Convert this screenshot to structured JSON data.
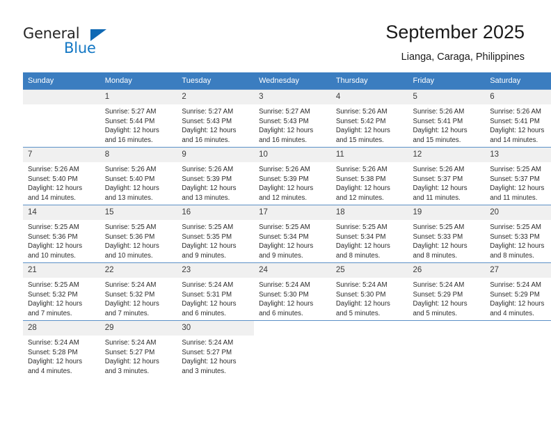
{
  "brand": {
    "name_part1": "General",
    "name_part2": "Blue",
    "triangle_color": "#1069b4"
  },
  "header": {
    "title": "September 2025",
    "subtitle": "Lianga, Caraga, Philippines",
    "header_bg": "#3b7dc0"
  },
  "weekdays": [
    "Sunday",
    "Monday",
    "Tuesday",
    "Wednesday",
    "Thursday",
    "Friday",
    "Saturday"
  ],
  "weeks": [
    [
      {
        "day": "",
        "sunrise": "",
        "sunset": "",
        "daylight1": "",
        "daylight2": "",
        "empty": true
      },
      {
        "day": "1",
        "sunrise": "Sunrise: 5:27 AM",
        "sunset": "Sunset: 5:44 PM",
        "daylight1": "Daylight: 12 hours",
        "daylight2": "and 16 minutes."
      },
      {
        "day": "2",
        "sunrise": "Sunrise: 5:27 AM",
        "sunset": "Sunset: 5:43 PM",
        "daylight1": "Daylight: 12 hours",
        "daylight2": "and 16 minutes."
      },
      {
        "day": "3",
        "sunrise": "Sunrise: 5:27 AM",
        "sunset": "Sunset: 5:43 PM",
        "daylight1": "Daylight: 12 hours",
        "daylight2": "and 16 minutes."
      },
      {
        "day": "4",
        "sunrise": "Sunrise: 5:26 AM",
        "sunset": "Sunset: 5:42 PM",
        "daylight1": "Daylight: 12 hours",
        "daylight2": "and 15 minutes."
      },
      {
        "day": "5",
        "sunrise": "Sunrise: 5:26 AM",
        "sunset": "Sunset: 5:41 PM",
        "daylight1": "Daylight: 12 hours",
        "daylight2": "and 15 minutes."
      },
      {
        "day": "6",
        "sunrise": "Sunrise: 5:26 AM",
        "sunset": "Sunset: 5:41 PM",
        "daylight1": "Daylight: 12 hours",
        "daylight2": "and 14 minutes."
      }
    ],
    [
      {
        "day": "7",
        "sunrise": "Sunrise: 5:26 AM",
        "sunset": "Sunset: 5:40 PM",
        "daylight1": "Daylight: 12 hours",
        "daylight2": "and 14 minutes."
      },
      {
        "day": "8",
        "sunrise": "Sunrise: 5:26 AM",
        "sunset": "Sunset: 5:40 PM",
        "daylight1": "Daylight: 12 hours",
        "daylight2": "and 13 minutes."
      },
      {
        "day": "9",
        "sunrise": "Sunrise: 5:26 AM",
        "sunset": "Sunset: 5:39 PM",
        "daylight1": "Daylight: 12 hours",
        "daylight2": "and 13 minutes."
      },
      {
        "day": "10",
        "sunrise": "Sunrise: 5:26 AM",
        "sunset": "Sunset: 5:39 PM",
        "daylight1": "Daylight: 12 hours",
        "daylight2": "and 12 minutes."
      },
      {
        "day": "11",
        "sunrise": "Sunrise: 5:26 AM",
        "sunset": "Sunset: 5:38 PM",
        "daylight1": "Daylight: 12 hours",
        "daylight2": "and 12 minutes."
      },
      {
        "day": "12",
        "sunrise": "Sunrise: 5:26 AM",
        "sunset": "Sunset: 5:37 PM",
        "daylight1": "Daylight: 12 hours",
        "daylight2": "and 11 minutes."
      },
      {
        "day": "13",
        "sunrise": "Sunrise: 5:25 AM",
        "sunset": "Sunset: 5:37 PM",
        "daylight1": "Daylight: 12 hours",
        "daylight2": "and 11 minutes."
      }
    ],
    [
      {
        "day": "14",
        "sunrise": "Sunrise: 5:25 AM",
        "sunset": "Sunset: 5:36 PM",
        "daylight1": "Daylight: 12 hours",
        "daylight2": "and 10 minutes."
      },
      {
        "day": "15",
        "sunrise": "Sunrise: 5:25 AM",
        "sunset": "Sunset: 5:36 PM",
        "daylight1": "Daylight: 12 hours",
        "daylight2": "and 10 minutes."
      },
      {
        "day": "16",
        "sunrise": "Sunrise: 5:25 AM",
        "sunset": "Sunset: 5:35 PM",
        "daylight1": "Daylight: 12 hours",
        "daylight2": "and 9 minutes."
      },
      {
        "day": "17",
        "sunrise": "Sunrise: 5:25 AM",
        "sunset": "Sunset: 5:34 PM",
        "daylight1": "Daylight: 12 hours",
        "daylight2": "and 9 minutes."
      },
      {
        "day": "18",
        "sunrise": "Sunrise: 5:25 AM",
        "sunset": "Sunset: 5:34 PM",
        "daylight1": "Daylight: 12 hours",
        "daylight2": "and 8 minutes."
      },
      {
        "day": "19",
        "sunrise": "Sunrise: 5:25 AM",
        "sunset": "Sunset: 5:33 PM",
        "daylight1": "Daylight: 12 hours",
        "daylight2": "and 8 minutes."
      },
      {
        "day": "20",
        "sunrise": "Sunrise: 5:25 AM",
        "sunset": "Sunset: 5:33 PM",
        "daylight1": "Daylight: 12 hours",
        "daylight2": "and 8 minutes."
      }
    ],
    [
      {
        "day": "21",
        "sunrise": "Sunrise: 5:25 AM",
        "sunset": "Sunset: 5:32 PM",
        "daylight1": "Daylight: 12 hours",
        "daylight2": "and 7 minutes."
      },
      {
        "day": "22",
        "sunrise": "Sunrise: 5:24 AM",
        "sunset": "Sunset: 5:32 PM",
        "daylight1": "Daylight: 12 hours",
        "daylight2": "and 7 minutes."
      },
      {
        "day": "23",
        "sunrise": "Sunrise: 5:24 AM",
        "sunset": "Sunset: 5:31 PM",
        "daylight1": "Daylight: 12 hours",
        "daylight2": "and 6 minutes."
      },
      {
        "day": "24",
        "sunrise": "Sunrise: 5:24 AM",
        "sunset": "Sunset: 5:30 PM",
        "daylight1": "Daylight: 12 hours",
        "daylight2": "and 6 minutes."
      },
      {
        "day": "25",
        "sunrise": "Sunrise: 5:24 AM",
        "sunset": "Sunset: 5:30 PM",
        "daylight1": "Daylight: 12 hours",
        "daylight2": "and 5 minutes."
      },
      {
        "day": "26",
        "sunrise": "Sunrise: 5:24 AM",
        "sunset": "Sunset: 5:29 PM",
        "daylight1": "Daylight: 12 hours",
        "daylight2": "and 5 minutes."
      },
      {
        "day": "27",
        "sunrise": "Sunrise: 5:24 AM",
        "sunset": "Sunset: 5:29 PM",
        "daylight1": "Daylight: 12 hours",
        "daylight2": "and 4 minutes."
      }
    ],
    [
      {
        "day": "28",
        "sunrise": "Sunrise: 5:24 AM",
        "sunset": "Sunset: 5:28 PM",
        "daylight1": "Daylight: 12 hours",
        "daylight2": "and 4 minutes."
      },
      {
        "day": "29",
        "sunrise": "Sunrise: 5:24 AM",
        "sunset": "Sunset: 5:27 PM",
        "daylight1": "Daylight: 12 hours",
        "daylight2": "and 3 minutes."
      },
      {
        "day": "30",
        "sunrise": "Sunrise: 5:24 AM",
        "sunset": "Sunset: 5:27 PM",
        "daylight1": "Daylight: 12 hours",
        "daylight2": "and 3 minutes."
      },
      {
        "day": "",
        "sunrise": "",
        "sunset": "",
        "daylight1": "",
        "daylight2": "",
        "blank": true
      },
      {
        "day": "",
        "sunrise": "",
        "sunset": "",
        "daylight1": "",
        "daylight2": "",
        "blank": true
      },
      {
        "day": "",
        "sunrise": "",
        "sunset": "",
        "daylight1": "",
        "daylight2": "",
        "blank": true
      },
      {
        "day": "",
        "sunrise": "",
        "sunset": "",
        "daylight1": "",
        "daylight2": "",
        "blank": true
      }
    ]
  ]
}
